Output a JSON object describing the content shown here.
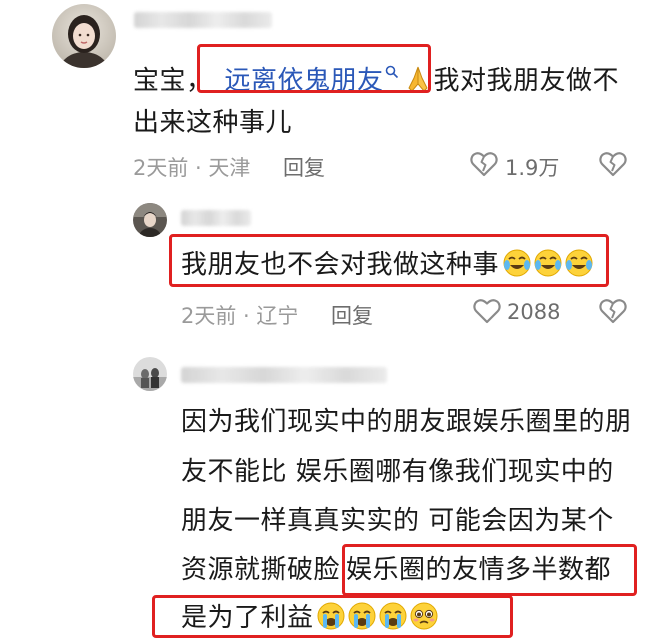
{
  "comments": [
    {
      "text_before_link": "宝宝，",
      "link_text": "远离依鬼朋友",
      "text_after_link": "我对我朋友做不",
      "line2": "出来这种事儿",
      "time": "2天前",
      "sep": " · ",
      "location": "天津",
      "reply_label": "回复",
      "like_count": "1.9万"
    },
    {
      "line1": "我朋友也不会对我做这种事",
      "time": "2天前",
      "sep": " · ",
      "location": "辽宁",
      "reply_label": "回复",
      "like_count": "2088"
    },
    {
      "lines": [
        "因为我们现实中的朋友跟娱乐圈里的朋",
        "友不能比 娱乐圈哪有像我们现实中的",
        "朋友一样真真实实的 可能会因为某个"
      ],
      "line4_a": "资源就撕破脸",
      "line4_b": "娱乐圈的友情多半数都",
      "line5": "是为了利益"
    }
  ],
  "icons": {
    "like": "heart-broken-icon",
    "dislike": "heart-broken-outline-icon",
    "search": "search-icon",
    "pray": "pray-emoji-icon",
    "cry_laugh": "tears-of-joy-emoji-icon",
    "sob": "sob-emoji-icon",
    "pleading": "pleading-emoji-icon"
  },
  "colors": {
    "highlight_box": "#e02020",
    "link": "#2b58b8",
    "meta": "#9a9a9a"
  }
}
